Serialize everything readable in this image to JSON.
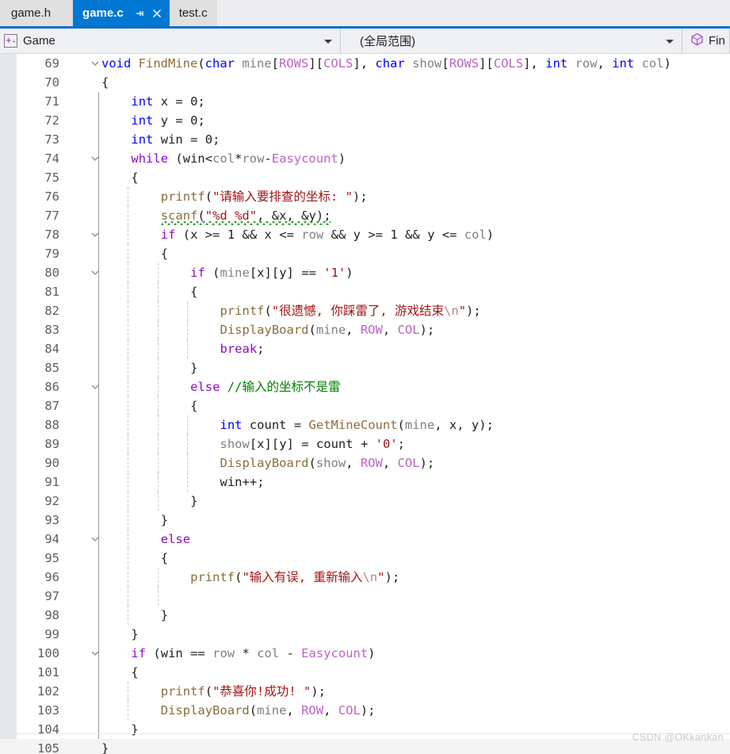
{
  "window": {
    "accent_color": "#0078d4",
    "tabbar_underline_color": "#0b6fc4"
  },
  "tabbar": {
    "tabs": [
      {
        "label": "game.h",
        "active": false
      },
      {
        "label": "game.c",
        "active": true
      },
      {
        "label": "test.c",
        "active": false
      }
    ],
    "pin_icon": "pin-icon",
    "close_icon": "close-icon"
  },
  "navbar": {
    "project_icon": "cpp-project-icon",
    "project_icon_glyph": "+₊",
    "scope_label": "Game",
    "global_scope_label": "(全局范围)",
    "member_icon": "cube-icon",
    "member_label": "Fin",
    "caret_icon": "chevron-down-icon"
  },
  "editor": {
    "current_line": 105,
    "first_line": 69,
    "lines": [
      {
        "n": 69,
        "fold": "open",
        "text": "void FindMine(char mine[ROWS][COLS], char show[ROWS][COLS], int row, int col)"
      },
      {
        "n": 70,
        "fold": "",
        "text": "{"
      },
      {
        "n": 71,
        "fold": "",
        "text": "    int x = 0;"
      },
      {
        "n": 72,
        "fold": "",
        "text": "    int y = 0;"
      },
      {
        "n": 73,
        "fold": "",
        "text": "    int win = 0;"
      },
      {
        "n": 74,
        "fold": "open",
        "text": "    while (win<col*row-Easycount)"
      },
      {
        "n": 75,
        "fold": "",
        "text": "    {"
      },
      {
        "n": 76,
        "fold": "",
        "text": "        printf(\"请输入要排查的坐标: \");"
      },
      {
        "n": 77,
        "fold": "",
        "text": "        scanf(\"%d %d\", &x, &y);"
      },
      {
        "n": 78,
        "fold": "open",
        "text": "        if (x >= 1 && x <= row && y >= 1 && y <= col)"
      },
      {
        "n": 79,
        "fold": "",
        "text": "        {"
      },
      {
        "n": 80,
        "fold": "open",
        "text": "            if (mine[x][y] == '1')"
      },
      {
        "n": 81,
        "fold": "",
        "text": "            {"
      },
      {
        "n": 82,
        "fold": "",
        "text": "                printf(\"很遗憾, 你踩雷了, 游戏结束\\n\");"
      },
      {
        "n": 83,
        "fold": "",
        "text": "                DisplayBoard(mine, ROW, COL);"
      },
      {
        "n": 84,
        "fold": "",
        "text": "                break;"
      },
      {
        "n": 85,
        "fold": "",
        "text": "            }"
      },
      {
        "n": 86,
        "fold": "open",
        "text": "            else //输入的坐标不是雷"
      },
      {
        "n": 87,
        "fold": "",
        "text": "            {"
      },
      {
        "n": 88,
        "fold": "",
        "text": "                int count = GetMineCount(mine, x, y);"
      },
      {
        "n": 89,
        "fold": "",
        "text": "                show[x][y] = count + '0';"
      },
      {
        "n": 90,
        "fold": "",
        "text": "                DisplayBoard(show, ROW, COL);"
      },
      {
        "n": 91,
        "fold": "",
        "text": "                win++;"
      },
      {
        "n": 92,
        "fold": "",
        "text": "            }"
      },
      {
        "n": 93,
        "fold": "",
        "text": "        }"
      },
      {
        "n": 94,
        "fold": "open",
        "text": "        else"
      },
      {
        "n": 95,
        "fold": "",
        "text": "        {"
      },
      {
        "n": 96,
        "fold": "",
        "text": "            printf(\"输入有误, 重新输入\\n\");"
      },
      {
        "n": 97,
        "fold": "",
        "text": ""
      },
      {
        "n": 98,
        "fold": "",
        "text": "        }"
      },
      {
        "n": 99,
        "fold": "",
        "text": "    }"
      },
      {
        "n": 100,
        "fold": "open",
        "text": "    if (win == row * col - Easycount)"
      },
      {
        "n": 101,
        "fold": "",
        "text": "    {"
      },
      {
        "n": 102,
        "fold": "",
        "text": "        printf(\"恭喜你!成功! \");"
      },
      {
        "n": 103,
        "fold": "",
        "text": "        DisplayBoard(mine, ROW, COL);"
      },
      {
        "n": 104,
        "fold": "",
        "text": "    }"
      },
      {
        "n": 105,
        "fold": "",
        "text": "}"
      }
    ],
    "diagnostics": [
      {
        "line": 77,
        "type": "warning-squiggle",
        "color": "#3a9e3a"
      }
    ],
    "syntax_colors": {
      "keyword": "#0000ff",
      "control": "#8f08c4",
      "macro": "#bd63c5",
      "function": "#8a6d3b",
      "string": "#a31515",
      "comment": "#008000",
      "identifier": "#808080",
      "punctuation": "#1f1f1f"
    }
  },
  "watermark": {
    "text": "CSDN @OKkankan"
  }
}
